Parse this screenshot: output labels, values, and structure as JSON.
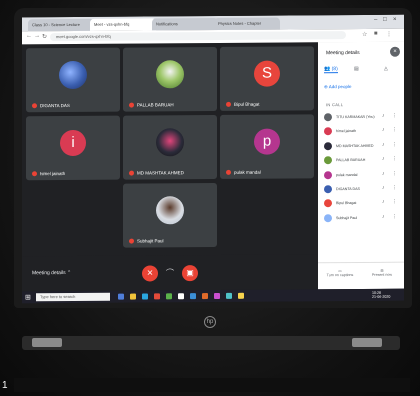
{
  "browser": {
    "tabs": [
      {
        "label": "Class 10 - Science Lecture"
      },
      {
        "label": "Meet - vzs-qxhn-bfq"
      },
      {
        "label": "Notifications"
      },
      {
        "label": "Physics Notes - Chapter"
      }
    ],
    "url": "meet.google.com/vzs-qxhn-bfq"
  },
  "meet": {
    "tiles": [
      {
        "name": "DIGANTA DAS",
        "kind": "photo",
        "color": "#3b5fb0"
      },
      {
        "name": "PALLAB BARUAH",
        "kind": "photo",
        "color": "#6a9a3a"
      },
      {
        "name": "Bipul Bhagat",
        "kind": "letter",
        "letter": "S",
        "color": "#e8453c"
      },
      {
        "name": "himel jainath",
        "kind": "letter",
        "letter": "i",
        "color": "#d93b53"
      },
      {
        "name": "MD MASHTAK AHMED",
        "kind": "photo",
        "color": "#2b2b3a"
      },
      {
        "name": "pulak mandal",
        "kind": "letter",
        "letter": "p",
        "color": "#b5368f"
      },
      {
        "name": "Subhajit Paul",
        "kind": "photo",
        "color": "#d9dde3"
      }
    ],
    "meeting_details_label": "Meeting details",
    "controls": {
      "mic_icon": "mic-off-icon",
      "end_icon": "phone-hangup-icon",
      "cam_icon": "camera-off-icon"
    }
  },
  "panel": {
    "title": "Meeting details",
    "close": "×",
    "tabs": [
      {
        "label": "(8)",
        "icon": "people-icon"
      },
      {
        "label": "",
        "icon": "chat-icon"
      },
      {
        "label": "",
        "icon": "activities-icon"
      }
    ],
    "add_people": "Add people",
    "section": "IN CALL",
    "participants": [
      {
        "name": "TITU KARMAKAR (You)",
        "color": "#5f6368"
      },
      {
        "name": "himel jainath",
        "color": "#d93b53"
      },
      {
        "name": "MD MASHTAK AHMED",
        "color": "#2b2b3a"
      },
      {
        "name": "PALLAB BARUAH",
        "color": "#6a9a3a"
      },
      {
        "name": "pulak mandal",
        "color": "#b5368f"
      },
      {
        "name": "DIGANTA DAS",
        "color": "#3b5fb0"
      },
      {
        "name": "Bipul Bhagat",
        "color": "#e8453c"
      },
      {
        "name": "Subhajit Paul",
        "color": "#8ab4f8"
      }
    ],
    "footer": [
      {
        "label": "Turn on captions"
      },
      {
        "label": "Present now"
      }
    ]
  },
  "taskbar": {
    "search_placeholder": "Type here to search",
    "time": "10:28",
    "date": "21-06-2020",
    "icons": [
      "#4f7ddb",
      "#f0c23b",
      "#2aa5e0",
      "#e34a3a",
      "#5bb14b",
      "#ffffff",
      "#3b8fd9",
      "#e06a2b",
      "#c94fd1",
      "#4fc2c9",
      "#f6d24d"
    ]
  },
  "laptop": {
    "logo": "hp"
  },
  "overlay": {
    "number": "1"
  }
}
